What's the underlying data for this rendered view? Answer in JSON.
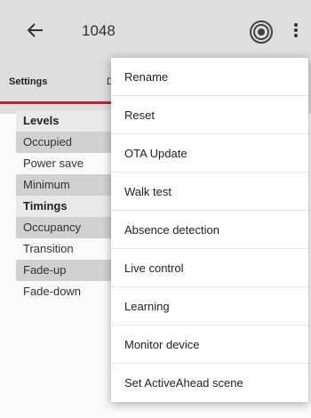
{
  "appbar": {
    "title": "1048"
  },
  "tabs": {
    "settings": "Settings",
    "other": "D"
  },
  "settings": {
    "rows": [
      {
        "label": "Levels"
      },
      {
        "label": "Occupied"
      },
      {
        "label": "Power save"
      },
      {
        "label": "Minimum"
      },
      {
        "label": "Timings"
      },
      {
        "label": "Occupancy"
      },
      {
        "label": "Transition"
      },
      {
        "label": "Fade-up"
      },
      {
        "label": "Fade-down"
      }
    ]
  },
  "menu": {
    "items": [
      {
        "label": "Rename"
      },
      {
        "label": "Reset"
      },
      {
        "label": "OTA Update"
      },
      {
        "label": "Walk test"
      },
      {
        "label": "Absence detection"
      },
      {
        "label": "Live control"
      },
      {
        "label": "Learning"
      },
      {
        "label": "Monitor device"
      },
      {
        "label": "Set ActiveAhead scene"
      }
    ]
  }
}
